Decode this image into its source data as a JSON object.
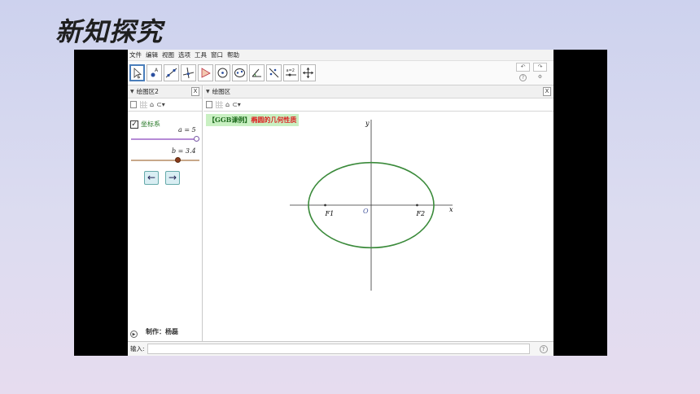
{
  "slide": {
    "title": "新知探究"
  },
  "menu": [
    "文件",
    "编辑",
    "视图",
    "选项",
    "工具",
    "窗口",
    "帮助"
  ],
  "toolbar": {
    "tools": [
      "move-tool-icon",
      "point-tool-icon",
      "line-tool-icon",
      "perpendicular-tool-icon",
      "polygon-tool-icon",
      "circle-tool-icon",
      "ellipse-tool-icon",
      "angle-tool-icon",
      "reflect-tool-icon",
      "slider-tool-icon",
      "move-view-tool-icon"
    ],
    "slider_tool_text": "a=2",
    "undo": "↶",
    "redo": "↷",
    "help_glyph": "?",
    "settings_glyph": "⚙"
  },
  "left_panel": {
    "header": "绘图区2",
    "close": "X",
    "checkbox_label": "坐标系",
    "checkbox_mark": "✓",
    "slider_a_label": "a = 5",
    "slider_b_label": "b = 3.4",
    "prev_button": "←",
    "next_button": "→",
    "author": "制作：杨磊",
    "play_glyph": "▶"
  },
  "right_panel": {
    "header": "绘图区",
    "close": "X",
    "banner_part1": "【GGB课例】",
    "banner_part2": "椭圆的几何性质",
    "axis_x": "x",
    "axis_y": "y",
    "origin": "O",
    "focus1": "F1",
    "focus2": "F2"
  },
  "input_bar": {
    "label": "输入:",
    "value": "",
    "help_glyph": "?"
  },
  "colors": {
    "ellipse": "#3a8a3a",
    "slider_a": "#b58ad6",
    "slider_b": "#c8a88a",
    "banner_bg": "#c9f0c2",
    "banner_red": "#dd2222",
    "label_green": "#2a7a2a"
  },
  "chart_data": {
    "type": "ellipse",
    "a": 5,
    "b": 3.4,
    "labels": [
      "x",
      "y",
      "O",
      "F1",
      "F2"
    ]
  }
}
